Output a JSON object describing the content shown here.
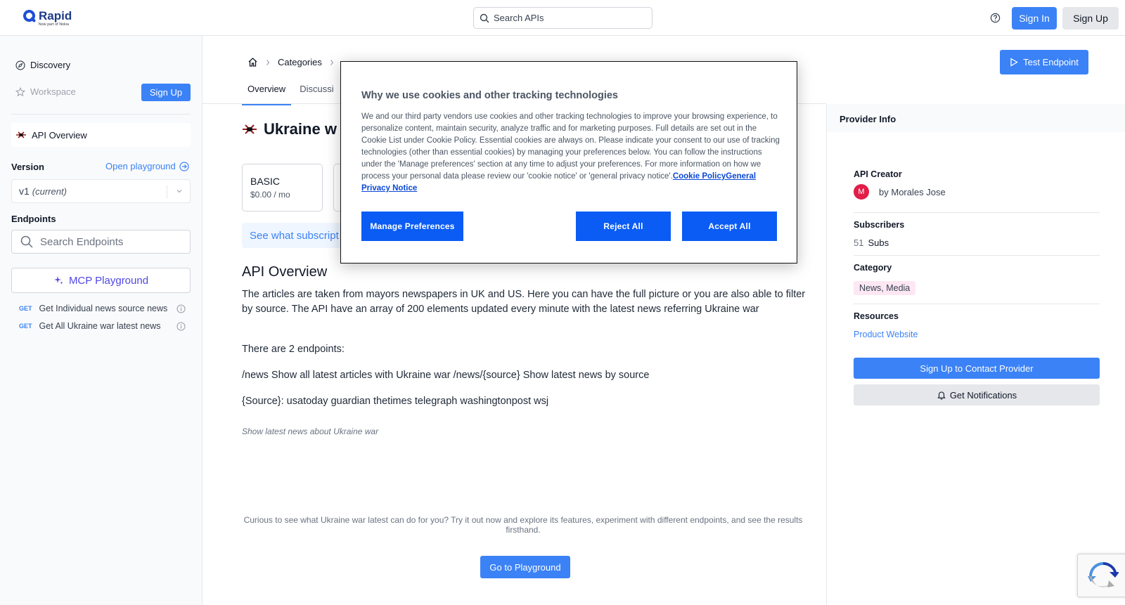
{
  "header": {
    "logo_name": "Rapid",
    "logo_sub": "Now part of Nokia",
    "search_placeholder": "Search APIs",
    "signin_label": "Sign In",
    "signup_label": "Sign Up"
  },
  "sidebar": {
    "discovery_label": "Discovery",
    "workspace_label": "Workspace",
    "signup_label": "Sign Up",
    "overview_label": "API Overview",
    "version_label": "Version",
    "open_playground_label": "Open playground",
    "version_value": "v1",
    "version_current": "(current)",
    "endpoints_label": "Endpoints",
    "endpoint_search_placeholder": "Search Endpoints",
    "mcp_label": "MCP Playground",
    "endpoints": [
      {
        "method": "GET",
        "name": "Get Individual news source news"
      },
      {
        "method": "GET",
        "name": "Get All Ukraine war latest news"
      }
    ]
  },
  "main": {
    "breadcrumb": {
      "categories": "Categories"
    },
    "tabs": [
      {
        "label": "Overview"
      },
      {
        "label": "Discussi"
      }
    ],
    "test_endpoint_label": "Test Endpoint",
    "api_title": "Ukraine w",
    "plan": {
      "name": "BASIC",
      "price": "$0.00 / mo"
    },
    "subscription_bar": "See what subscript",
    "overview_heading": "API Overview",
    "paragraphs": [
      "The articles are taken from mayors newspapers in UK and US. Here you can have the full picture or you are also able to filter by source. The API have an array of 200 elements updated every minute with the latest news referring Ukraine war",
      "There are 2 endpoints:",
      "/news Show all latest articles with Ukraine war /news/{source} Show latest news by source",
      "{Source}: usatoday guardian thetimes telegraph washingtonpost wsj"
    ],
    "italic_note": "Show latest news about Ukraine war",
    "curious_text": "Curious to see what Ukraine war latest can do for you? Try it out now and explore its features, experiment with different endpoints, and see the results firsthand.",
    "go_playground_label": "Go to Playground"
  },
  "provider": {
    "heading": "Provider Info",
    "creator_label": "API Creator",
    "avatar_letter": "M",
    "creator_prefix": "by",
    "creator_name": "Morales Jose",
    "subscribers_label": "Subscribers",
    "subscribers_count": "51",
    "subscribers_unit": "Subs",
    "category_label": "Category",
    "category_value": "News, Media",
    "resources_label": "Resources",
    "product_website_label": "Product Website",
    "contact_label": "Sign Up to Contact Provider",
    "notifications_label": "Get Notifications"
  },
  "cookie": {
    "title": "Why we use cookies and other tracking technologies",
    "body": "We and our third party vendors use cookies and other tracking technologies to improve your browsing experience, to personalize content, maintain security, analyze traffic and for marketing purposes. Full details are set out in the Cookie List under Cookie Policy. Essential cookies are always on. Please indicate your consent to our use of tracking technologies (other than essential cookies) by managing your preferences below. You can follow the instructions under the 'Manage preferences' section at any time to adjust your preferences. For more information on how we process your personal data please review our 'cookie notice' or 'general privacy notice'.",
    "cookie_policy_link": "Cookie Policy",
    "privacy_link": "General Privacy Notice",
    "manage_label": "Manage Preferences",
    "reject_label": "Reject All",
    "accept_label": "Accept All"
  },
  "colors": {
    "accent": "#3b82f6",
    "cookie_button": "#0b5cf5",
    "category_badge": "#fce7f3",
    "avatar": "#e11d48"
  }
}
